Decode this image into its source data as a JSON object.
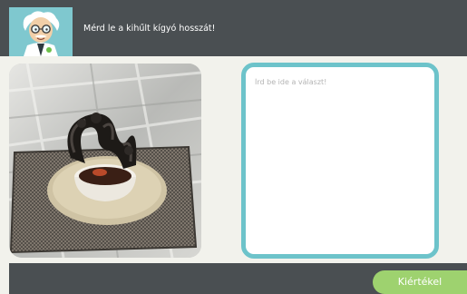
{
  "header": {
    "prompt": "Mérd le a kihűlt kígyó hosszát!"
  },
  "answer": {
    "placeholder": "Írd be ide a választ!",
    "value": ""
  },
  "footer": {
    "submit_label": "Kiértékel"
  },
  "colors": {
    "header_bg": "#4a4f52",
    "avatar_bg": "#7fc8cf",
    "answer_border": "#6dc3ca",
    "submit_bg": "#9ed26f",
    "page_bg": "#f2f2ec"
  },
  "icons": {
    "avatar": "scientist-avatar-icon"
  }
}
